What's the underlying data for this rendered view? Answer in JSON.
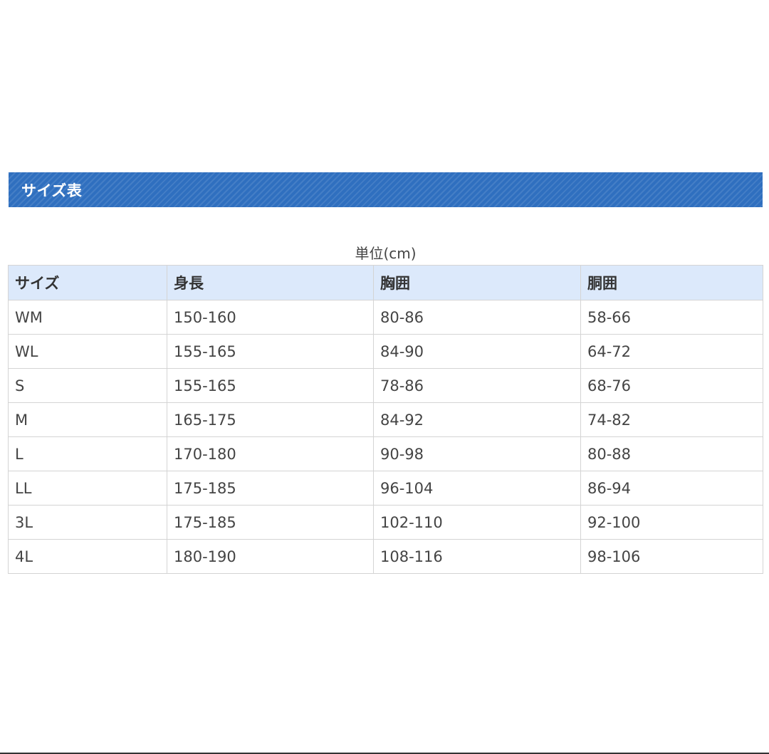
{
  "section": {
    "title": "サイズ表"
  },
  "unit_caption": "単位(cm)",
  "table": {
    "headers": [
      "サイズ",
      "身長",
      "胸囲",
      "胴囲"
    ],
    "rows": [
      [
        "WM",
        "150-160",
        "80-86",
        "58-66"
      ],
      [
        "WL",
        "155-165",
        "84-90",
        "64-72"
      ],
      [
        "S",
        "155-165",
        "78-86",
        "68-76"
      ],
      [
        "M",
        "165-175",
        "84-92",
        "74-82"
      ],
      [
        "L",
        "170-180",
        "90-98",
        "80-88"
      ],
      [
        "LL",
        "175-185",
        "96-104",
        "86-94"
      ],
      [
        "3L",
        "175-185",
        "102-110",
        "92-100"
      ],
      [
        "4L",
        "180-190",
        "108-116",
        "98-106"
      ]
    ]
  },
  "colors": {
    "header_band": "#2f6fbf",
    "table_header_bg": "#dce9fb",
    "border": "#d4d4d4"
  }
}
